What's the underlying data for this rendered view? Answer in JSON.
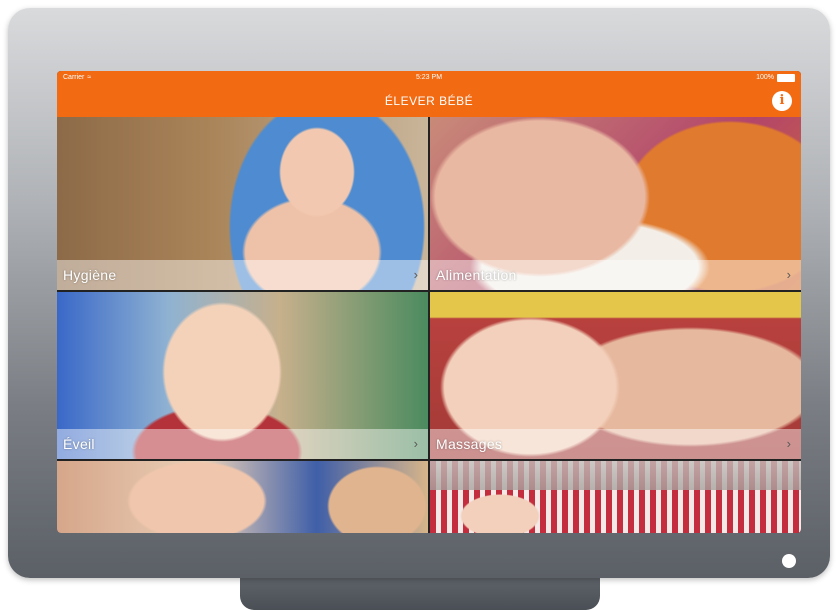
{
  "status_bar": {
    "carrier": "Carrier",
    "wifi_icon": "wifi-icon",
    "time": "5:23 PM",
    "battery": "100%"
  },
  "nav_bar": {
    "title": "ÉLEVER BÉBÉ",
    "info_icon": "info-icon",
    "info_glyph": "i",
    "color": "#f26a12"
  },
  "tiles": [
    {
      "label": "Hygiène",
      "chevron": "›"
    },
    {
      "label": "Alimentation",
      "chevron": "›"
    },
    {
      "label": "Éveil",
      "chevron": "›"
    },
    {
      "label": "Massages",
      "chevron": "›"
    }
  ],
  "device": {
    "home_button_icon": "home-button"
  }
}
